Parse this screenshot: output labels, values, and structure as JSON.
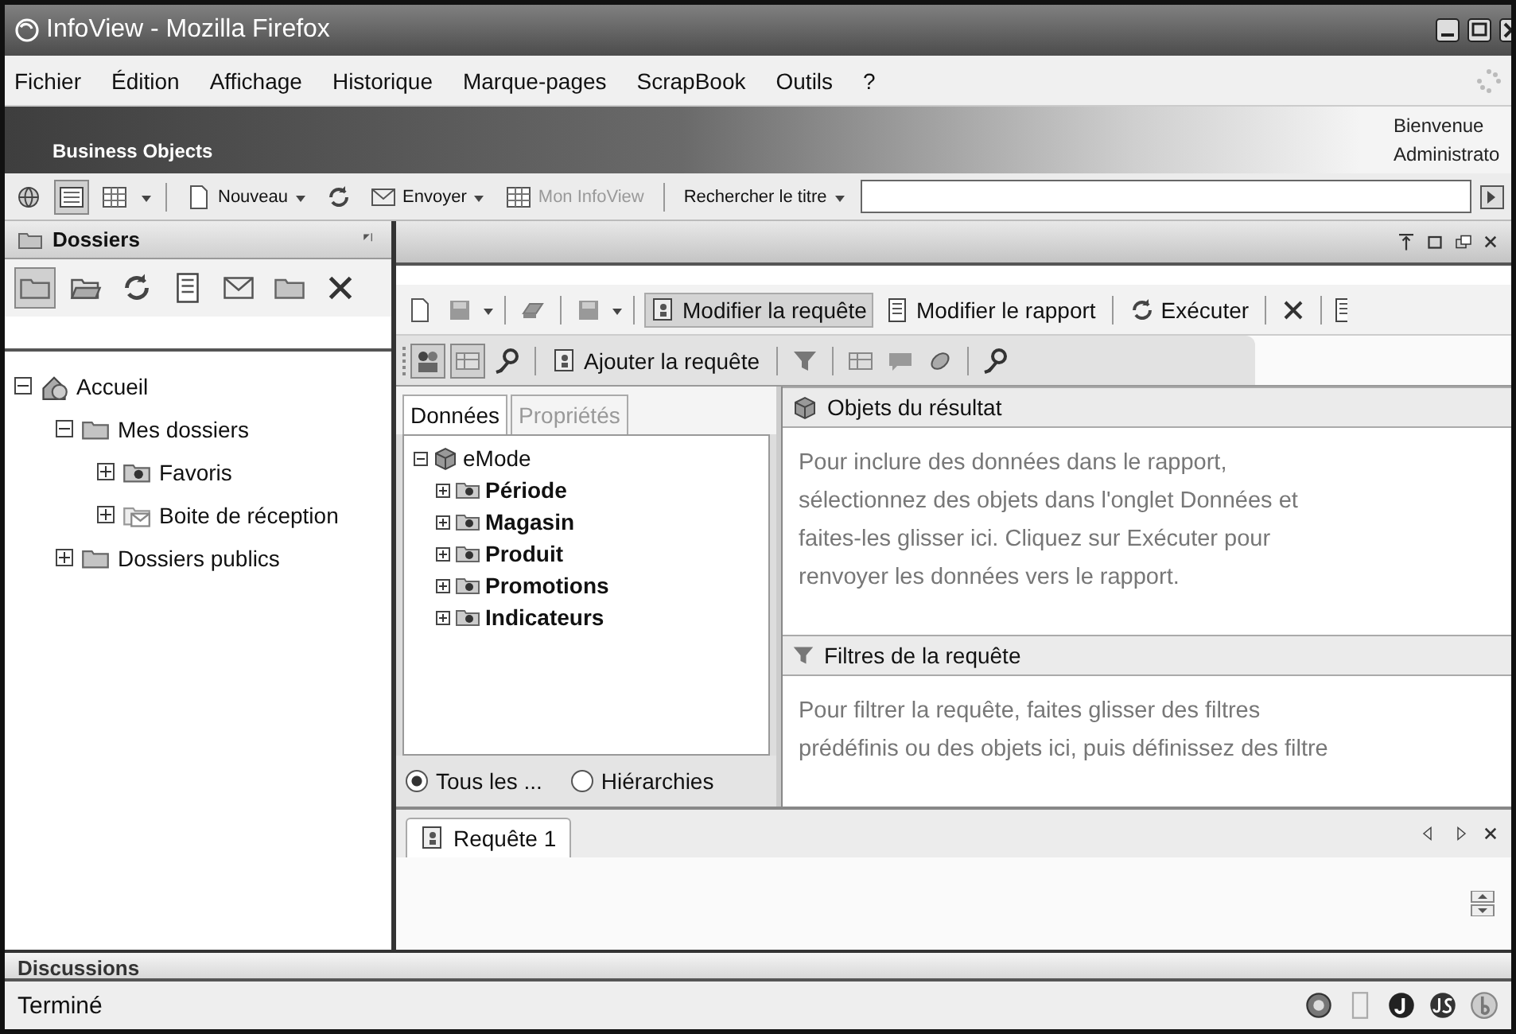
{
  "window": {
    "title": "InfoView - Mozilla Firefox"
  },
  "menu": [
    "Fichier",
    "Édition",
    "Affichage",
    "Historique",
    "Marque-pages",
    "ScrapBook",
    "Outils",
    "?"
  ],
  "banner": {
    "logo": "Business Objects",
    "welcome": [
      "Bienvenue",
      "Administrato"
    ]
  },
  "toolbar": {
    "view_buttons": [
      {
        "selected": false
      },
      {
        "selected": true
      },
      {
        "selected": false
      }
    ],
    "new": "Nouveau",
    "send": "Envoyer",
    "my_infoview": {
      "label": "Mon InfoView",
      "disabled": true
    },
    "search_title": "Rechercher le titre"
  },
  "folders_panel": {
    "title": "Dossiers",
    "tools": [
      {
        "selected": true
      },
      {
        "selected": false
      },
      {
        "selected": false
      },
      {
        "selected": false
      },
      {
        "selected": false
      },
      {
        "selected": false
      },
      {
        "selected": false
      }
    ],
    "tree": [
      {
        "label": "Accueil",
        "kind": "home",
        "expanded": true,
        "children": [
          {
            "label": "Mes dossiers",
            "kind": "folder",
            "expanded": true,
            "children": [
              {
                "label": "Favoris",
                "kind": "favorites",
                "expanded": false
              },
              {
                "label": "Boite de réception",
                "kind": "inbox",
                "expanded": false
              }
            ]
          },
          {
            "label": "Dossiers publics",
            "kind": "folder",
            "expanded": false
          }
        ]
      }
    ]
  },
  "report_toolbar": [
    {
      "label": "Modifier la requête",
      "selected": true
    },
    {
      "label": "Modifier le rapport",
      "selected": false
    },
    {
      "label": "Exécuter",
      "selected": false
    }
  ],
  "query_toolbar": {
    "pressed": [
      true,
      true,
      false
    ],
    "add_query": "Ajouter la requête"
  },
  "data_panel": {
    "tabs": [
      {
        "label": "Données",
        "selected": true
      },
      {
        "label": "Propriétés",
        "selected": false
      }
    ],
    "universe": {
      "label": "eMode",
      "expanded": true,
      "children": [
        {
          "label": "Période",
          "expanded": false
        },
        {
          "label": "Magasin",
          "expanded": false
        },
        {
          "label": "Produit",
          "expanded": false
        },
        {
          "label": "Promotions",
          "expanded": false
        },
        {
          "label": "Indicateurs",
          "expanded": false
        }
      ]
    },
    "radios": [
      {
        "label": "Tous les ...",
        "selected": true
      },
      {
        "label": "Hiérarchies",
        "selected": false
      }
    ]
  },
  "result_objects": {
    "title": "Objets du résultat",
    "text": "Pour inclure des données dans le rapport,\nsélectionnez des objets dans l'onglet Données et\nfaites-les glisser ici. Cliquez sur Exécuter pour\nrenvoyer les données vers le rapport."
  },
  "query_filters": {
    "title": "Filtres de la requête",
    "text": "Pour filtrer la requête, faites glisser des filtres\nprédéfinis ou des objets ici, puis définissez des filtre"
  },
  "query_tabs": [
    {
      "label": "Requête 1",
      "selected": true
    }
  ],
  "discussions": "Discussions",
  "status_bar": "Terminé"
}
